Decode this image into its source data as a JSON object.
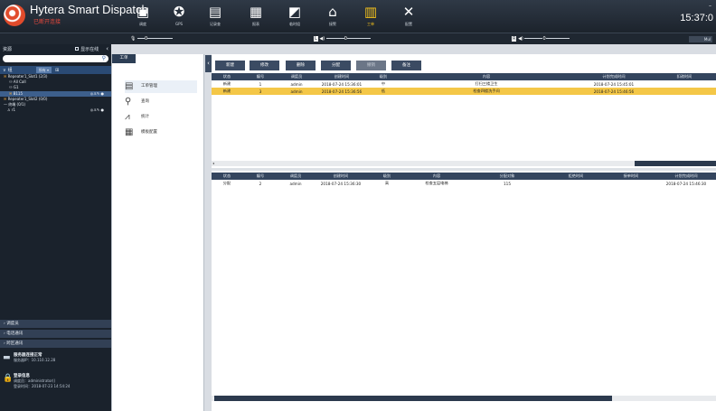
{
  "window": {
    "title": "Hytera Smart Dispatch",
    "subtitle": "已断开连接",
    "clock": "15:37:0",
    "corner": "–"
  },
  "toolbar_top": [
    {
      "label": "调度",
      "icon": "monitor-icon"
    },
    {
      "label": "GPS",
      "icon": "gps-icon"
    },
    {
      "label": "记录查",
      "icon": "record-icon"
    },
    {
      "label": "报表",
      "icon": "report-icon"
    },
    {
      "label": "临时组",
      "icon": "temp-group-icon"
    },
    {
      "label": "接警",
      "icon": "alarm-icon"
    },
    {
      "label": "工单",
      "icon": "work-order-icon",
      "active": true
    },
    {
      "label": "配置",
      "icon": "config-icon"
    }
  ],
  "strip": {
    "mic_level": "0",
    "left_channel": "L",
    "left_volume": "0",
    "right_channel": "R",
    "right_volume": "0",
    "mode": "Mul"
  },
  "left_panel": {
    "header": "资源",
    "show_online_label": "显示在线",
    "search": {
      "placeholder": "",
      "value": ""
    },
    "group_label": "组",
    "filter_value": "所有",
    "tree": [
      {
        "label": "Repeater1_Slot1 (2/3)",
        "right": ""
      },
      {
        "label": "All Call",
        "right": ""
      },
      {
        "label": "G1",
        "right": ""
      },
      {
        "label": "B115",
        "right": "◎⚓✎ ●",
        "selected": true
      },
      {
        "label": "Repeater1_Slot2 (0/0)",
        "right": ""
      },
      {
        "label": "终端 (0/1)",
        "right": ""
      },
      {
        "label": "r1",
        "right": "◎⚓✎ ●"
      }
    ],
    "sections": [
      "调度员",
      "电话通讯",
      "跨区通讯"
    ],
    "service_status": {
      "title": "服务器连接正常",
      "detail": "服务器IP：10.110.12.28"
    },
    "login_info": {
      "title": "登录信息",
      "user": "调度员：administrator()",
      "time": "登录时间：2018-07-23 14:54:24"
    }
  },
  "menu": {
    "tab": "工单",
    "items": [
      {
        "label": "工单管理",
        "icon": "work-order-manage-icon",
        "selected": true
      },
      {
        "label": "查询",
        "icon": "query-icon"
      },
      {
        "label": "统计",
        "icon": "statistics-icon"
      },
      {
        "label": "模板配置",
        "icon": "template-config-icon"
      }
    ]
  },
  "actions": {
    "new": "新建",
    "edit": "修改",
    "delete": "删除",
    "dispatch": "分配",
    "revoke": "撤销",
    "remark": "备注"
  },
  "orders_table": {
    "columns": [
      "状态",
      "编号",
      "调度员",
      "创建时间",
      "级别",
      "内容",
      "计划完成时间",
      "扣改时间"
    ],
    "rows": [
      [
        "新建",
        "1",
        "admin",
        "2018-07-24 15:36:01",
        "中",
        "打扫三楼卫生",
        "2018-07-24 15:45:01",
        ""
      ],
      [
        "新建",
        "3",
        "admin",
        "2018-07-24 15:36:56",
        "低",
        "检查四楼洗手间",
        "2018-07-24 15:46:56",
        ""
      ]
    ],
    "selected_row": 1
  },
  "assign_table": {
    "columns": [
      "状态",
      "编号",
      "调度员",
      "创建时间",
      "级别",
      "内容",
      "分配对象",
      "拒绝时间",
      "接单时间",
      "计划完成时间"
    ],
    "rows": [
      [
        "分配",
        "2",
        "admin",
        "2018-07-24 15:36:30",
        "高",
        "检查五层电梯",
        "115",
        "",
        "",
        "2018-07-24 15:46:30"
      ]
    ]
  }
}
